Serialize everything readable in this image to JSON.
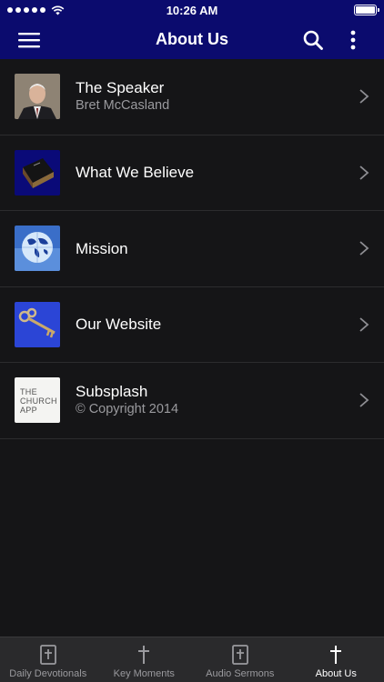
{
  "status_bar": {
    "time": "10:26 AM"
  },
  "header": {
    "title": "About Us"
  },
  "list": {
    "items": [
      {
        "title": "The Speaker",
        "subtitle": "Bret McCasland",
        "icon": "speaker-photo"
      },
      {
        "title": "What We Believe",
        "subtitle": "",
        "icon": "bible-icon"
      },
      {
        "title": "Mission",
        "subtitle": "",
        "icon": "globe-icon"
      },
      {
        "title": "Our Website",
        "subtitle": "",
        "icon": "key-icon"
      },
      {
        "title": "Subsplash",
        "subtitle": "© Copyright 2014",
        "icon": "church-app-logo"
      }
    ]
  },
  "church_app_logo": "THE CHURCH APP",
  "tabs": [
    {
      "label": "Daily Devotionals",
      "icon": "bible-icon",
      "active": false
    },
    {
      "label": "Key Moments",
      "icon": "cross-icon",
      "active": false
    },
    {
      "label": "Audio Sermons",
      "icon": "bible-icon",
      "active": false
    },
    {
      "label": "About Us",
      "icon": "cross-icon",
      "active": true
    }
  ],
  "colors": {
    "bar_blue": "#0b0b6e",
    "background": "#151517",
    "tabbar": "#2a2a2c",
    "muted": "#9a9a9e"
  }
}
